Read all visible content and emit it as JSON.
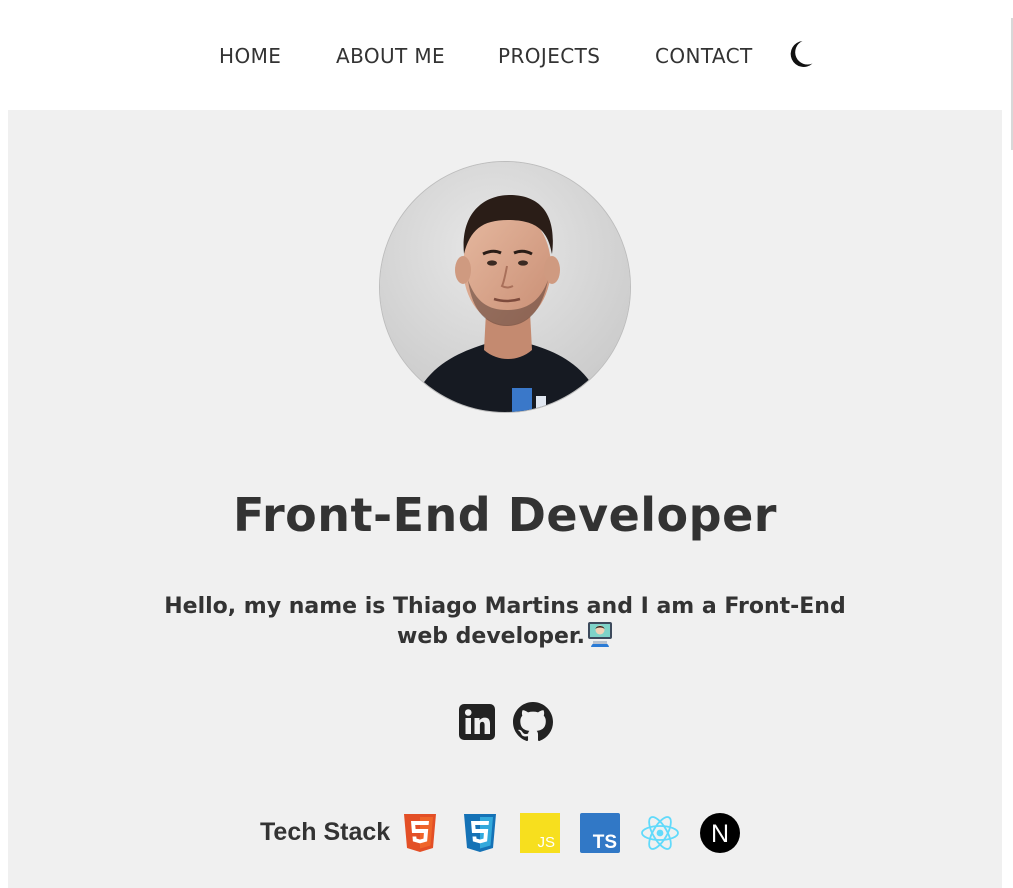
{
  "nav": {
    "home": "HOME",
    "about": "ABOUT ME",
    "projects": "PROJECTS",
    "contact": "CONTACT",
    "theme_icon": "moon-icon"
  },
  "hero": {
    "avatar": "profile-photo",
    "headline": "Front-End Developer",
    "intro": "Hello, my name is Thiago Martins and I am a Front-End web developer.",
    "intro_emoji": "technologist-emoji"
  },
  "socials": [
    {
      "name": "linkedin",
      "icon": "linkedin-icon"
    },
    {
      "name": "github",
      "icon": "github-icon"
    }
  ],
  "tech_stack": {
    "label": "Tech Stack",
    "items": [
      {
        "name": "html5",
        "icon": "html5-icon",
        "color": "#e34f26"
      },
      {
        "name": "css3",
        "icon": "css3-icon",
        "color": "#1572b6"
      },
      {
        "name": "javascript",
        "icon": "javascript-icon",
        "color": "#f7df1e",
        "text": "JS"
      },
      {
        "name": "typescript",
        "icon": "typescript-icon",
        "color": "#3178c6",
        "text": "TS"
      },
      {
        "name": "react",
        "icon": "react-icon",
        "color": "#61dafb"
      },
      {
        "name": "nextjs",
        "icon": "nextjs-icon",
        "color": "#000000",
        "text": "N"
      }
    ]
  },
  "colors": {
    "text": "#333333",
    "hero_background": "#f0f0f0",
    "header_background": "#ffffff"
  }
}
